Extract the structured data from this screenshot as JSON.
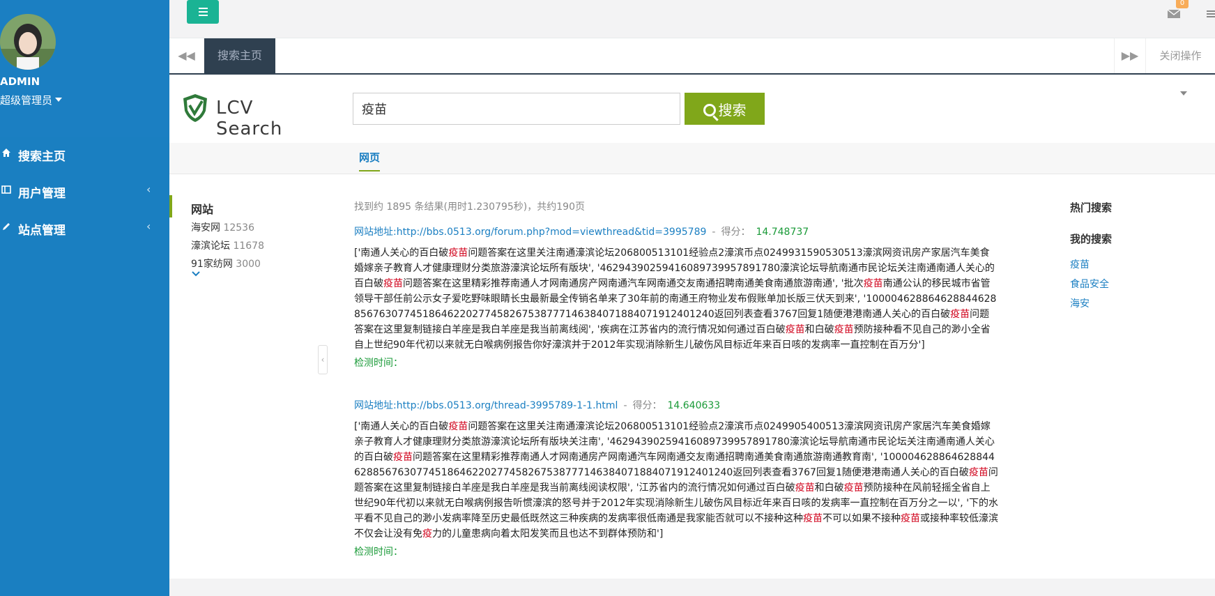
{
  "sidebar": {
    "admin_name": "ADMIN",
    "admin_role": "超级管理员",
    "items": [
      {
        "label": "搜索主页",
        "icon": "home-icon"
      },
      {
        "label": "用户管理",
        "icon": "user-icon"
      },
      {
        "label": "站点管理",
        "icon": "edit-icon"
      }
    ]
  },
  "topbar": {
    "mail_count": "0"
  },
  "tabs": {
    "active": "搜索主页",
    "close_ops": "关闭操作"
  },
  "search": {
    "logo_text": "LCV Search",
    "query": "疫苗",
    "button": "搜索"
  },
  "subnav": {
    "tab": "网页"
  },
  "filter": {
    "title": "网站",
    "items": [
      {
        "name": "海安网",
        "count": "12536"
      },
      {
        "name": "濠滨论坛",
        "count": "11678"
      },
      {
        "name": "91家纺网",
        "count": "3000"
      }
    ]
  },
  "results": {
    "stats": "找到约 1895 条结果(用时1.230795秒)，共约190页",
    "items": [
      {
        "url": "网站地址:http://bbs.0513.org/forum.php?mod=viewthread&tid=3995789",
        "score_label": "得分：",
        "score": "14.748737",
        "time_label": "检测时间："
      },
      {
        "url": "网站地址:http://bbs.0513.org/thread-3995789-1-1.html",
        "score_label": "得分：",
        "score": "14.640633",
        "time_label": "检测时间："
      }
    ]
  },
  "right": {
    "hot_title": "热门搜索",
    "my_title": "我的搜索",
    "my_items": [
      "疫苗",
      "食品安全",
      "海安"
    ]
  },
  "colors": {
    "sidebar_blue": "#1b7fc2",
    "accent_green": "#80a71a",
    "toggle_green": "#1ab394",
    "highlight_red": "#d0021b"
  }
}
